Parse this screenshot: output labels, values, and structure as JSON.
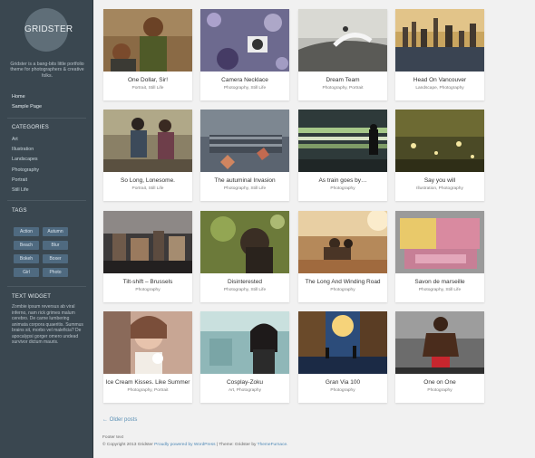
{
  "site": {
    "logo": "GRIDSTER",
    "tagline": "Gridster is a bang-bits little portfolio theme for photographers & creative folks."
  },
  "menu": [
    "Home",
    "Sample Page"
  ],
  "categories": {
    "title": "CATEGORIES",
    "items": [
      "Art",
      "Illustration",
      "Landscapes",
      "Photography",
      "Portrait",
      "Still Life"
    ]
  },
  "tags": {
    "title": "TAGS",
    "items": [
      "Action",
      "Autumn",
      "Beach",
      "Blur",
      "Bokeh",
      "Boxer",
      "Girl",
      "Photo"
    ]
  },
  "text_widget": {
    "title": "TEXT WIDGET",
    "body": "Zombie ipsum reversus ab viral inferno, nam rick grimes malum cerebro. De carne lumbering animata corpora quaeritis. Summus brains sit, morbo vel maleficia? De apocalypsi gorger omero undead survivor dictum mauris."
  },
  "posts": [
    {
      "title": "One Dollar, Sir!",
      "cats": "Portrait, Still Life"
    },
    {
      "title": "Camera Necklace",
      "cats": "Photography, Still Life"
    },
    {
      "title": "Dream Team",
      "cats": "Photography, Portrait"
    },
    {
      "title": "Head On Vancouver",
      "cats": "Landscape, Photography"
    },
    {
      "title": "So Long, Lonesome.",
      "cats": "Portrait, Still Life"
    },
    {
      "title": "The autuminal Invasion",
      "cats": "Photography, Still Life"
    },
    {
      "title": "As train goes by…",
      "cats": "Photography"
    },
    {
      "title": "Say you will",
      "cats": "Illustration, Photography"
    },
    {
      "title": "Tilt-shift – Brussels",
      "cats": "Photography"
    },
    {
      "title": "Disinterested",
      "cats": "Photography, Still Life"
    },
    {
      "title": "The Long And Winding Road",
      "cats": "Photography"
    },
    {
      "title": "Savon de marseille",
      "cats": "Photography, Still Life"
    },
    {
      "title": "Ice Cream Kisses. Like Summer",
      "cats": "Photography, Portrait"
    },
    {
      "title": "Cosplay-Zoku",
      "cats": "Art, Photography"
    },
    {
      "title": "Gran Via 100",
      "cats": "Photography"
    },
    {
      "title": "One on One",
      "cats": "Photography"
    }
  ],
  "pagination": {
    "older": "← Older posts"
  },
  "footer": {
    "text": "Footer text",
    "copyright_prefix": "© Copyright 2013 Gridster",
    "powered": "Proudly powered by WordPress",
    "theme_prefix": " | Theme: Gridster by ",
    "theme_author": "ThemeFurnace."
  }
}
